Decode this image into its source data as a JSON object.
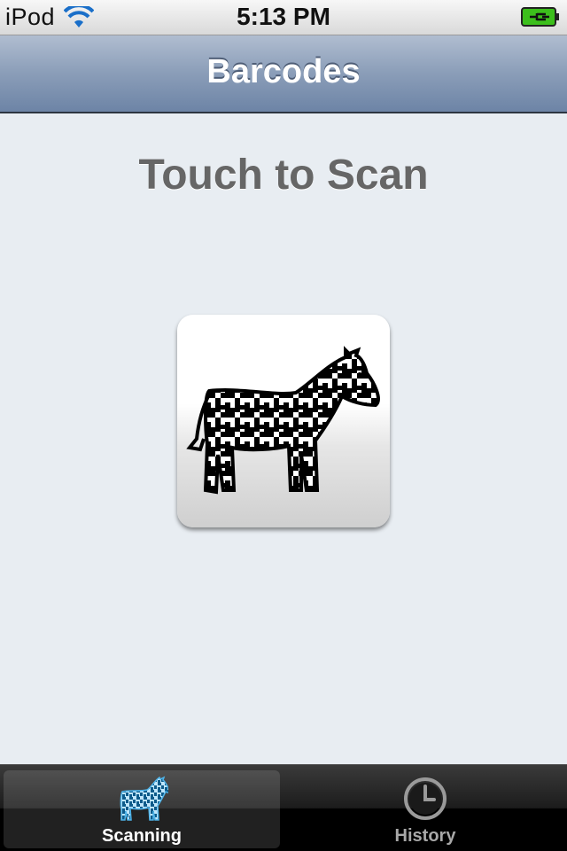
{
  "status_bar": {
    "carrier": "iPod",
    "time": "5:13 PM",
    "wifi_icon": "wifi-icon",
    "battery_icon": "battery-charging-icon",
    "battery_color": "#3cbf1c"
  },
  "nav_bar": {
    "title": "Barcodes"
  },
  "main": {
    "prompt": "Touch to Scan",
    "scan_button_icon": "zebra-barcode-icon"
  },
  "tab_bar": {
    "selected": "Scanning",
    "accent_color": "#4fb3e8",
    "tabs": [
      {
        "label": "Scanning",
        "icon": "zebra-icon",
        "active": true
      },
      {
        "label": "History",
        "icon": "clock-icon",
        "active": false
      }
    ]
  }
}
